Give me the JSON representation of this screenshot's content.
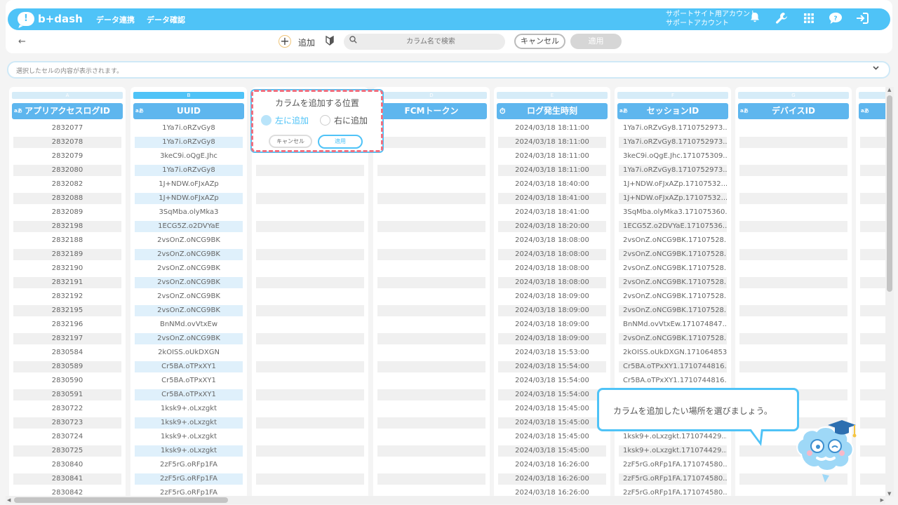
{
  "header": {
    "logo_text": "b+dash",
    "logo_mark": "!",
    "nav": [
      "データ連携",
      "データ確認"
    ],
    "account_line1": "サポートサイト用アカウント",
    "account_line2": "サポートアカウント",
    "icons": [
      "bell-icon",
      "wrench-icon",
      "grid-icon",
      "help-chat-icon",
      "logout-icon"
    ]
  },
  "toolbar": {
    "back_glyph": "←",
    "add_glyph": "+",
    "add_label": "追加",
    "search_placeholder": "カラム名で検索",
    "cancel_label": "キャンセル",
    "apply_label": "適用"
  },
  "cell_bar": {
    "text": "選択したセルの内容が表示されます。"
  },
  "columns": [
    {
      "letter": "A",
      "title": "アプリアクセスログID",
      "type_badge": "aあ",
      "values": [
        "2832077",
        "2832078",
        "2832079",
        "2832080",
        "2832082",
        "2832088",
        "2832089",
        "2832198",
        "2832188",
        "2832189",
        "2832190",
        "2832191",
        "2832192",
        "2832195",
        "2832196",
        "2832197",
        "2830584",
        "2830589",
        "2830590",
        "2830591",
        "2830722",
        "2830723",
        "2830724",
        "2830725",
        "2830840",
        "2830841",
        "2830842"
      ]
    },
    {
      "letter": "B",
      "title": "UUID",
      "type_badge": "aあ",
      "selected": true,
      "values": [
        "1Ya7i.oRZvGy8",
        "1Ya7i.oRZvGy8",
        "3keC9i.oQgE.Jhc",
        "1Ya7i.oRZvGy8",
        "1J+NDW.oFJxAZp",
        "1J+NDW.oFJxAZp",
        "3SqMba.olyMka3",
        "1ECG5Z.o2DVYaE",
        "2vsOnZ.oNCG9BK",
        "2vsOnZ.oNCG9BK",
        "2vsOnZ.oNCG9BK",
        "2vsOnZ.oNCG9BK",
        "2vsOnZ.oNCG9BK",
        "2vsOnZ.oNCG9BK",
        "BnNMd.ovVtxEw",
        "2vsOnZ.oNCG9BK",
        "2kOISS.oUkDXGN",
        "Cr5BA.oTPxXY1",
        "Cr5BA.oTPxXY1",
        "Cr5BA.oTPxXY1",
        "1ksk9+.oLxzgkt",
        "1ksk9+.oLxzgkt",
        "1ksk9+.oLxzgkt",
        "1ksk9+.oLxzgkt",
        "2zF5rG.oRFp1FA",
        "2zF5rG.oRFp1FA",
        "2zF5rG.oRFp1FA"
      ]
    },
    {
      "letter": "C",
      "title": "",
      "type_badge": "",
      "values": []
    },
    {
      "letter": "D",
      "title": "FCMトークン",
      "type_badge": "",
      "values": []
    },
    {
      "letter": "E",
      "title": "ログ発生時刻",
      "type_badge": "clock",
      "values": [
        "2024/03/18 18:11:00",
        "2024/03/18 18:11:00",
        "2024/03/18 18:11:00",
        "2024/03/18 18:11:00",
        "2024/03/18 18:40:00",
        "2024/03/18 18:41:00",
        "2024/03/18 18:41:00",
        "2024/03/18 18:20:00",
        "2024/03/18 18:08:00",
        "2024/03/18 18:08:00",
        "2024/03/18 18:08:00",
        "2024/03/18 18:08:00",
        "2024/03/18 18:09:00",
        "2024/03/18 18:09:00",
        "2024/03/18 18:09:00",
        "2024/03/18 18:09:00",
        "2024/03/18 15:53:00",
        "2024/03/18 15:54:00",
        "2024/03/18 15:54:00",
        "2024/03/18 15:54:00",
        "2024/03/18 15:45:00",
        "2024/03/18 15:45:00",
        "2024/03/18 15:45:00",
        "2024/03/18 15:45:00",
        "2024/03/18 16:26:00",
        "2024/03/18 16:26:00",
        "2024/03/18 16:26:00"
      ]
    },
    {
      "letter": "F",
      "title": "セッションID",
      "type_badge": "aあ",
      "values": [
        "1Ya7i.oRZvGy8.1710752973...",
        "1Ya7i.oRZvGy8.1710752973...",
        "3keC9i.oQgE.Jhc.171075309...",
        "1Ya7i.oRZvGy8.1710752973...",
        "1J+NDW.oFJxAZp.17107532...",
        "1J+NDW.oFJxAZp.17107532...",
        "3SqMba.olyMka3.171075360...",
        "1ECG5Z.o2DVYaE.17107536...",
        "2vsOnZ.oNCG9BK.17107528...",
        "2vsOnZ.oNCG9BK.17107528...",
        "2vsOnZ.oNCG9BK.17107528...",
        "2vsOnZ.oNCG9BK.17107528...",
        "2vsOnZ.oNCG9BK.17107528...",
        "2vsOnZ.oNCG9BK.17107528...",
        "BnNMd.ovVtxEw.171074847...",
        "2vsOnZ.oNCG9BK.17107528...",
        "2kOISS.oUkDXGN.171064853...",
        "Cr5BA.oTPxXY1.1710744816...",
        "Cr5BA.oTPxXY1.1710744816...",
        "",
        "",
        "",
        "1ksk9+.oLxzgkt.171074429...",
        "1ksk9+.oLxzgkt.171074429...",
        "2zF5rG.oRFp1FA.171074580...",
        "2zF5rG.oRFp1FA.171074580...",
        "2zF5rG.oRFp1FA.171074580..."
      ]
    },
    {
      "letter": "G",
      "title": "デバイスID",
      "type_badge": "aあ",
      "values": []
    },
    {
      "letter": "",
      "title": "",
      "type_badge": "aあ",
      "values": []
    }
  ],
  "popup": {
    "title": "カラムを追加する位置",
    "option_left": "左に追加",
    "option_right": "右に追加",
    "selected": "left",
    "cancel_label": "キャンセル",
    "apply_label": "適用"
  },
  "tooltip": {
    "text": "カラムを追加したい場所を選びましょう。"
  },
  "colors": {
    "accent": "#4fc3f7",
    "header_col": "#5eb6ee",
    "highlight_outline": "#f07080"
  }
}
